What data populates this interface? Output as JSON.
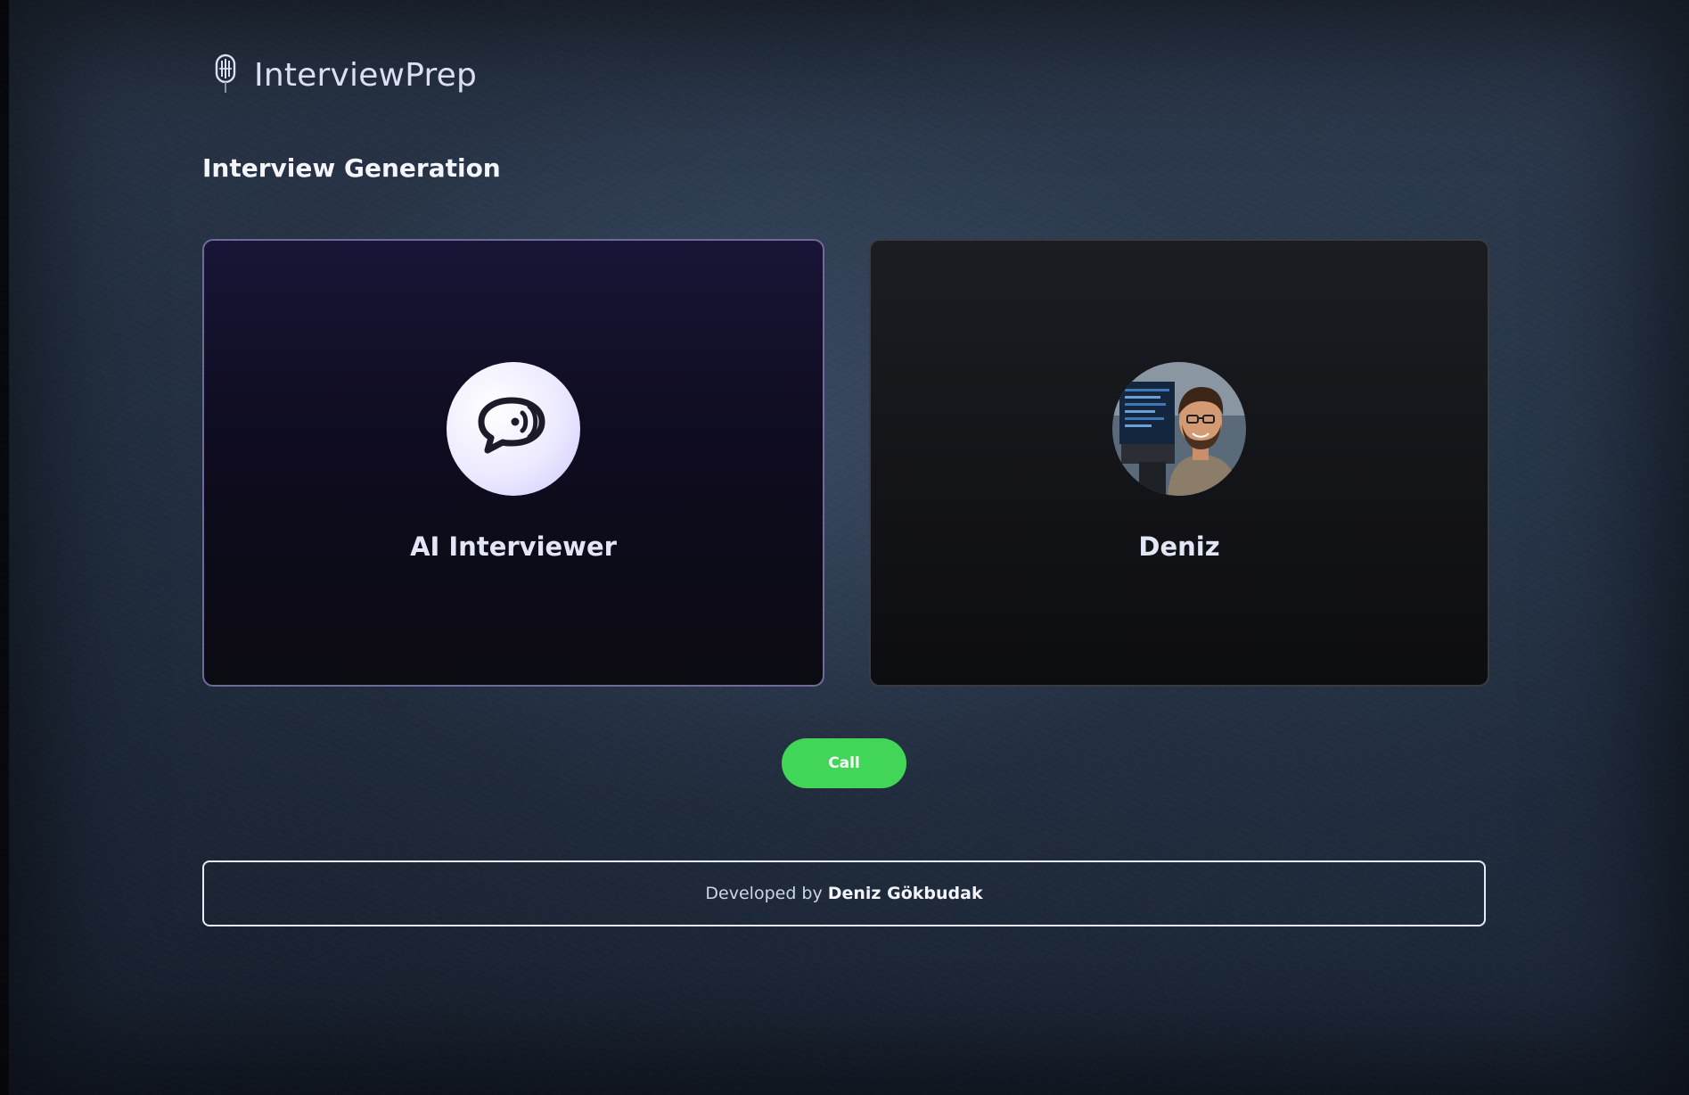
{
  "app": {
    "name": "InterviewPrep",
    "logo_icon": "mic-icon"
  },
  "page": {
    "title": "Interview Generation"
  },
  "cards": {
    "ai": {
      "label": "AI Interviewer",
      "icon": "voice-chat-icon"
    },
    "user": {
      "label": "Deniz",
      "icon": "user-avatar"
    }
  },
  "actions": {
    "call_label": "Call"
  },
  "footer": {
    "prefix": "Developed by",
    "author": "Deniz Gökbudak"
  },
  "colors": {
    "call_button": "#41d657",
    "ai_card_border": "#6f6a9a",
    "ai_card_bg": "#181536",
    "user_card_bg": "#1b1d22"
  }
}
